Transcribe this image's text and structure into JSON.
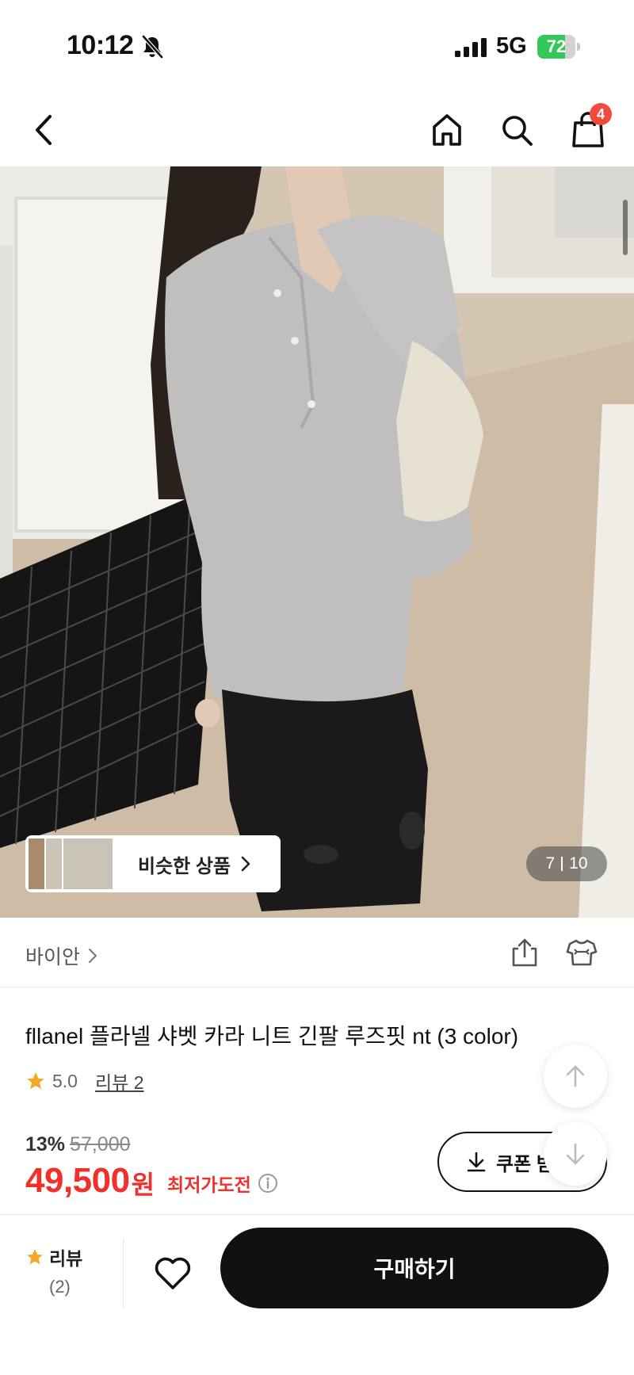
{
  "status_bar": {
    "time": "10:12",
    "network": "5G",
    "battery_level": "72",
    "battery_fraction": 0.72,
    "icons": [
      "bell-slash-icon",
      "signal-icon"
    ]
  },
  "nav": {
    "cart_count": "4",
    "icons": [
      "back-icon",
      "home-icon",
      "search-icon",
      "shopping-bag-icon"
    ]
  },
  "hero": {
    "similar_label": "비슷한 상품",
    "current_page": "7",
    "total_pages": "10"
  },
  "brand": {
    "name": "바이안",
    "icons": [
      "share-icon",
      "fitting-icon"
    ]
  },
  "product": {
    "title": "fllanel 플라넬  샤벳 카라 니트 긴팔 루즈핏 nt (3 color)",
    "rating": "5.0",
    "review_link": "리뷰 2",
    "discount_rate": "13%",
    "original_price": "57,000",
    "price": "49,500",
    "price_unit": "원",
    "lowest_label": "최저가도전",
    "coupon_label": "쿠폰 받"
  },
  "bottom_bar": {
    "review_label": "리뷰",
    "review_count": "(2)",
    "buy_label": "구매하기"
  },
  "colors": {
    "accent_red": "#f0302b",
    "badge_red": "#f24a3e",
    "star": "#f5a623",
    "battery_green": "#34c759",
    "primary_button": "#111111"
  }
}
